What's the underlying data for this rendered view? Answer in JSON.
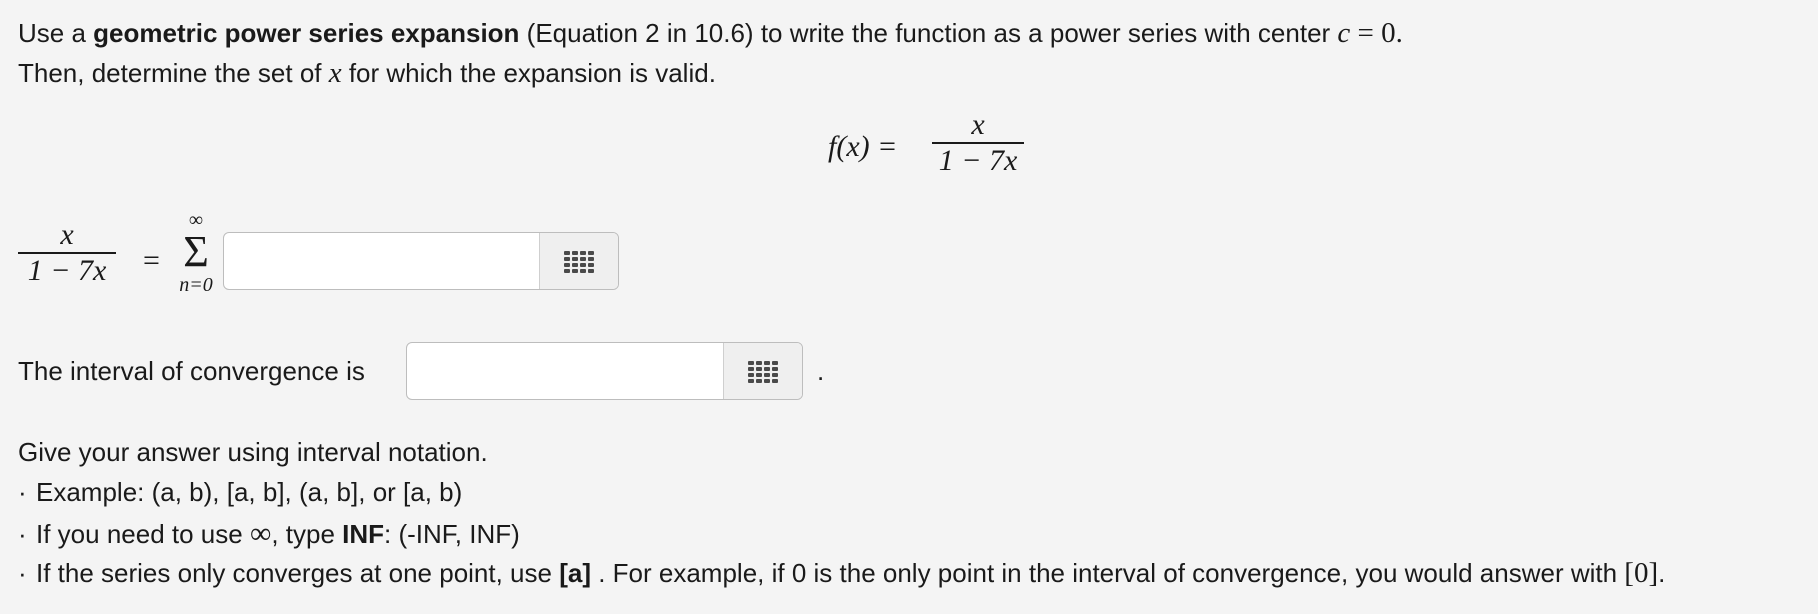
{
  "prompt": {
    "line1_pre": "Use a ",
    "line1_bold": "geometric power series expansion",
    "line1_post": " (Equation 2 in 10.6) to write the function as a power series with center ",
    "line1_var": "c",
    "line1_eq": " = 0.",
    "line2_pre": "Then, determine the set of ",
    "line2_var": "x",
    "line2_post": " for which the expansion is valid."
  },
  "function_display": {
    "lhs": "f(x) =",
    "numerator": "x",
    "denominator": "1 − 7x"
  },
  "series": {
    "numerator": "x",
    "denominator": "1 − 7x",
    "equals": "=",
    "sum_upper": "∞",
    "sum_symbol": "Σ",
    "sum_lower": "n=0",
    "input_value": "",
    "palette_icon": "keypad-grid-icon"
  },
  "interval": {
    "label": "The interval of convergence is",
    "input_value": "",
    "trailing": ".",
    "palette_icon": "keypad-grid-icon"
  },
  "instructions": {
    "intro": "Give your answer using interval notation.",
    "bullet_char": "·",
    "b1": "Example: (a, b), [a, b], (a, b], or [a, b)",
    "b2_pre": "If you need to use ",
    "b2_sym": "∞",
    "b2_mid": ", type ",
    "b2_bold": "INF",
    "b2_post": ": (-INF, INF)",
    "b3_pre": "If the series only converges at one point, use ",
    "b3_bold": "[a]",
    "b3_mid": " . For example, if 0 is the only point in the interval of convergence, you would answer with ",
    "b3_math": "[0]",
    "b3_end": "."
  }
}
